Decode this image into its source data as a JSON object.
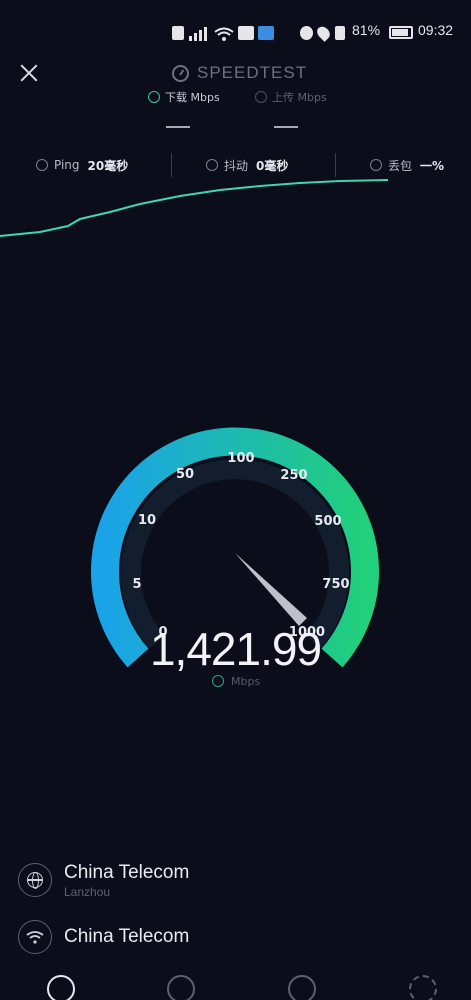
{
  "status_bar": {
    "battery": "81%",
    "time": "09:32",
    "icons": [
      "hd-icon",
      "signal-icon",
      "wifi-icon",
      "camera-icon",
      "image-icon",
      "alarm-icon",
      "location-icon",
      "vibrate-icon",
      "battery-icon"
    ]
  },
  "header": {
    "title": "SPEEDTEST",
    "download_tab": "下载 Mbps",
    "upload_tab": "上传 Mbps",
    "download_value": "—",
    "upload_value": "—"
  },
  "metrics": {
    "ping": {
      "label": "Ping",
      "value": "20毫秒"
    },
    "jitter": {
      "label": "抖动",
      "value": "0毫秒"
    },
    "loss": {
      "label": "丢包",
      "value": "一%"
    }
  },
  "gauge": {
    "ticks": [
      "0",
      "5",
      "10",
      "50",
      "100",
      "250",
      "500",
      "750",
      "1000"
    ],
    "speed": "1,421.99",
    "unit": "Mbps",
    "progress": 1.0,
    "needle_value": 1000,
    "colors": {
      "start": "#1aa3e8",
      "end": "#21d07a",
      "graph": "#3fd6b0"
    }
  },
  "provider": {
    "server_name": "China Telecom",
    "server_location": "Lanzhou",
    "isp_name": "China Telecom"
  },
  "nav": [
    "speed-nav-icon",
    "results-nav-icon",
    "coverage-nav-icon",
    "settings-nav-icon"
  ]
}
